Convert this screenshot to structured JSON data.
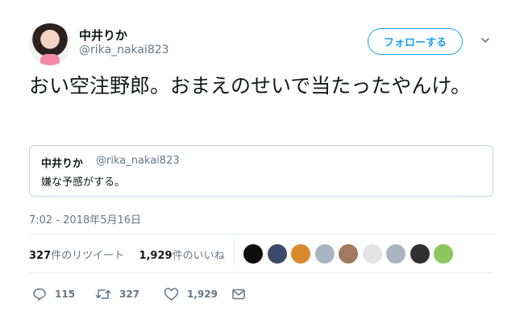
{
  "author": {
    "name": "中井りか",
    "handle": "@rika_nakai823"
  },
  "follow_button_label": "フォローする",
  "tweet_text": "おい空注野郎。おまえのせいで当たったやんけ。",
  "quoted_tweet": {
    "name": "中井りか",
    "handle": "@rika_nakai823",
    "text": "嫌な予感がする。"
  },
  "timestamp": "7:02 - 2018年5月16日",
  "stats": {
    "retweets_count": "327",
    "retweets_label": "件のリツイート",
    "likes_count": "1,929",
    "likes_label": "件のいいね"
  },
  "likers": [
    {
      "icon": "liker-avatar-1",
      "color": "#0d0d0d"
    },
    {
      "icon": "liker-avatar-2",
      "color": "#3b4a6b"
    },
    {
      "icon": "liker-avatar-3",
      "color": "#d8892b"
    },
    {
      "icon": "liker-avatar-4",
      "color": "#a9b6c2"
    },
    {
      "icon": "liker-avatar-5",
      "color": "#a27a5d"
    },
    {
      "icon": "liker-avatar-6",
      "color": "#e3e3e3"
    },
    {
      "icon": "liker-avatar-7",
      "color": "#a9b6c2"
    },
    {
      "icon": "liker-avatar-8",
      "color": "#2f2f2f"
    },
    {
      "icon": "liker-avatar-9",
      "color": "#8cc65d"
    }
  ],
  "actions": {
    "reply_count": "115",
    "retweet_count": "327",
    "like_count": "1,929"
  },
  "colors": {
    "accent": "#1da1f2",
    "muted": "#657786",
    "border": "#e6ecf0"
  }
}
